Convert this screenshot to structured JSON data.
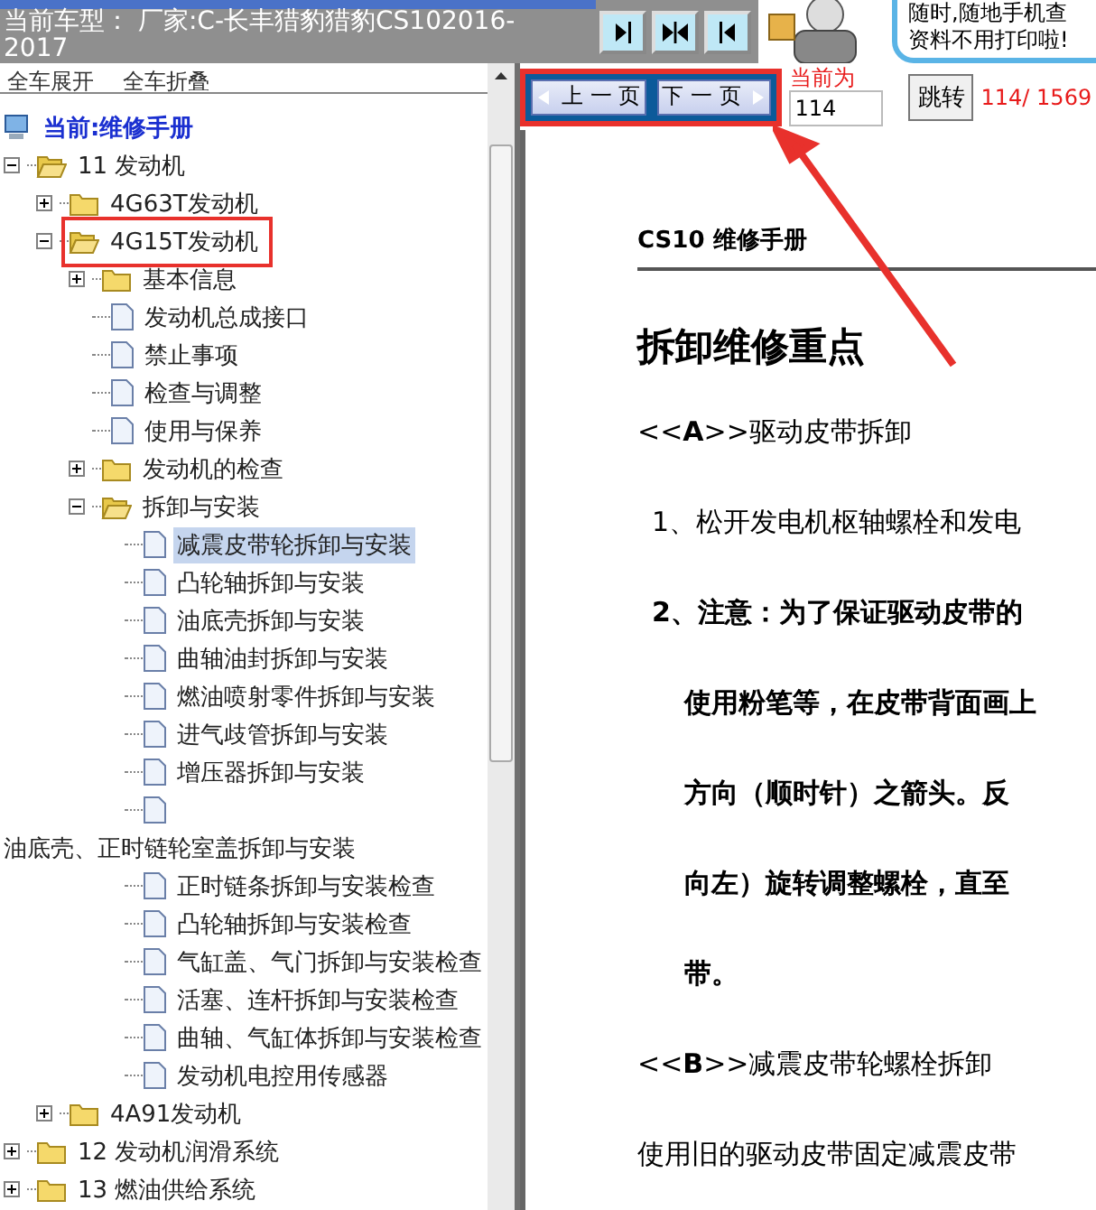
{
  "header": {
    "title_lines": [
      "当前车型： 厂家:C-长丰猎豹猎豹CS102016-",
      "2017"
    ]
  },
  "promo": {
    "lines": [
      "随时,随地手机查",
      "资料不用打印啦!"
    ]
  },
  "tree_actions": [
    "全车展开",
    "全车折叠"
  ],
  "tree_root": {
    "label": "当前:维修手册"
  },
  "tree": [
    {
      "label": "11 发动机",
      "kind": "folder",
      "expanded": true,
      "selected": false,
      "children": [
        {
          "label": "4G63T发动机",
          "kind": "folder",
          "expanded": false,
          "selected": false
        },
        {
          "label": "4G15T发动机",
          "kind": "folder",
          "expanded": true,
          "selected": false,
          "highlighted": true,
          "children": [
            {
              "label": "基本信息",
              "kind": "folder",
              "expanded": false,
              "selected": false
            },
            {
              "label": "发动机总成接口",
              "kind": "doc",
              "selected": false
            },
            {
              "label": "禁止事项",
              "kind": "doc",
              "selected": false
            },
            {
              "label": "检查与调整",
              "kind": "doc",
              "selected": false
            },
            {
              "label": "使用与保养",
              "kind": "doc",
              "selected": false
            },
            {
              "label": "发动机的检查",
              "kind": "folder",
              "expanded": false,
              "selected": false
            },
            {
              "label": "拆卸与安装",
              "kind": "folder",
              "expanded": true,
              "selected": false,
              "children": [
                {
                  "label": "减震皮带轮拆卸与安装",
                  "kind": "doc",
                  "selected": true
                },
                {
                  "label": "凸轮轴拆卸与安装",
                  "kind": "doc",
                  "selected": false
                },
                {
                  "label": "油底壳拆卸与安装",
                  "kind": "doc",
                  "selected": false
                },
                {
                  "label": "曲轴油封拆卸与安装",
                  "kind": "doc",
                  "selected": false
                },
                {
                  "label": "燃油喷射零件拆卸与安装",
                  "kind": "doc",
                  "selected": false
                },
                {
                  "label": "进气歧管拆卸与安装",
                  "kind": "doc",
                  "selected": false
                },
                {
                  "label": "增压器拆卸与安装",
                  "kind": "doc",
                  "selected": false
                },
                {
                  "label": "油底壳、正时链轮室盖拆卸与安装",
                  "kind": "doc",
                  "selected": false,
                  "label_wraps": true
                },
                {
                  "label": "正时链条拆卸与安装检查",
                  "kind": "doc",
                  "selected": false
                },
                {
                  "label": "凸轮轴拆卸与安装检查",
                  "kind": "doc",
                  "selected": false
                },
                {
                  "label": "气缸盖、气门拆卸与安装检查",
                  "kind": "doc",
                  "selected": false
                },
                {
                  "label": "活塞、连杆拆卸与安装检查",
                  "kind": "doc",
                  "selected": false
                },
                {
                  "label": "曲轴、气缸体拆卸与安装检查",
                  "kind": "doc",
                  "selected": false
                },
                {
                  "label": "发动机电控用传感器",
                  "kind": "doc",
                  "selected": false
                }
              ]
            }
          ]
        },
        {
          "label": "4A91发动机",
          "kind": "folder",
          "expanded": false,
          "selected": false
        }
      ]
    },
    {
      "label": "12 发动机润滑系统",
      "kind": "folder",
      "expanded": false,
      "selected": false
    },
    {
      "label": "13 燃油供给系统",
      "kind": "folder",
      "expanded": false,
      "selected": false
    }
  ],
  "pager": {
    "prev": "上 一 页",
    "next": "下 一 页",
    "highlighted": true,
    "current_label": "当前为",
    "page_value": "114",
    "go": "跳转",
    "page_count": "114/ 1569"
  },
  "document": {
    "header": "CS10 维修手册",
    "heading": "拆卸维修重点",
    "paragraphs": [
      {
        "kind": "section",
        "text": "<<**A**>>驱动皮带拆卸"
      },
      {
        "kind": "step",
        "text": "1、松开发电机枢轴螺栓和发电"
      },
      {
        "kind": "step-bold",
        "text": "2、注意：为了保证驱动皮带的"
      },
      {
        "kind": "continuation",
        "text": "使用粉笔等，在皮带背面画上"
      },
      {
        "kind": "continuation",
        "text": "方向（顺时针）之箭头。反"
      },
      {
        "kind": "continuation",
        "text": "向左）旋转调整螺栓，直至"
      },
      {
        "kind": "continuation",
        "text": "带。"
      },
      {
        "kind": "section",
        "text": "<<**B**>>减震皮带轮螺栓拆卸"
      },
      {
        "kind": "plain",
        "text": "使用旧的驱动皮带固定减震皮带"
      }
    ]
  }
}
